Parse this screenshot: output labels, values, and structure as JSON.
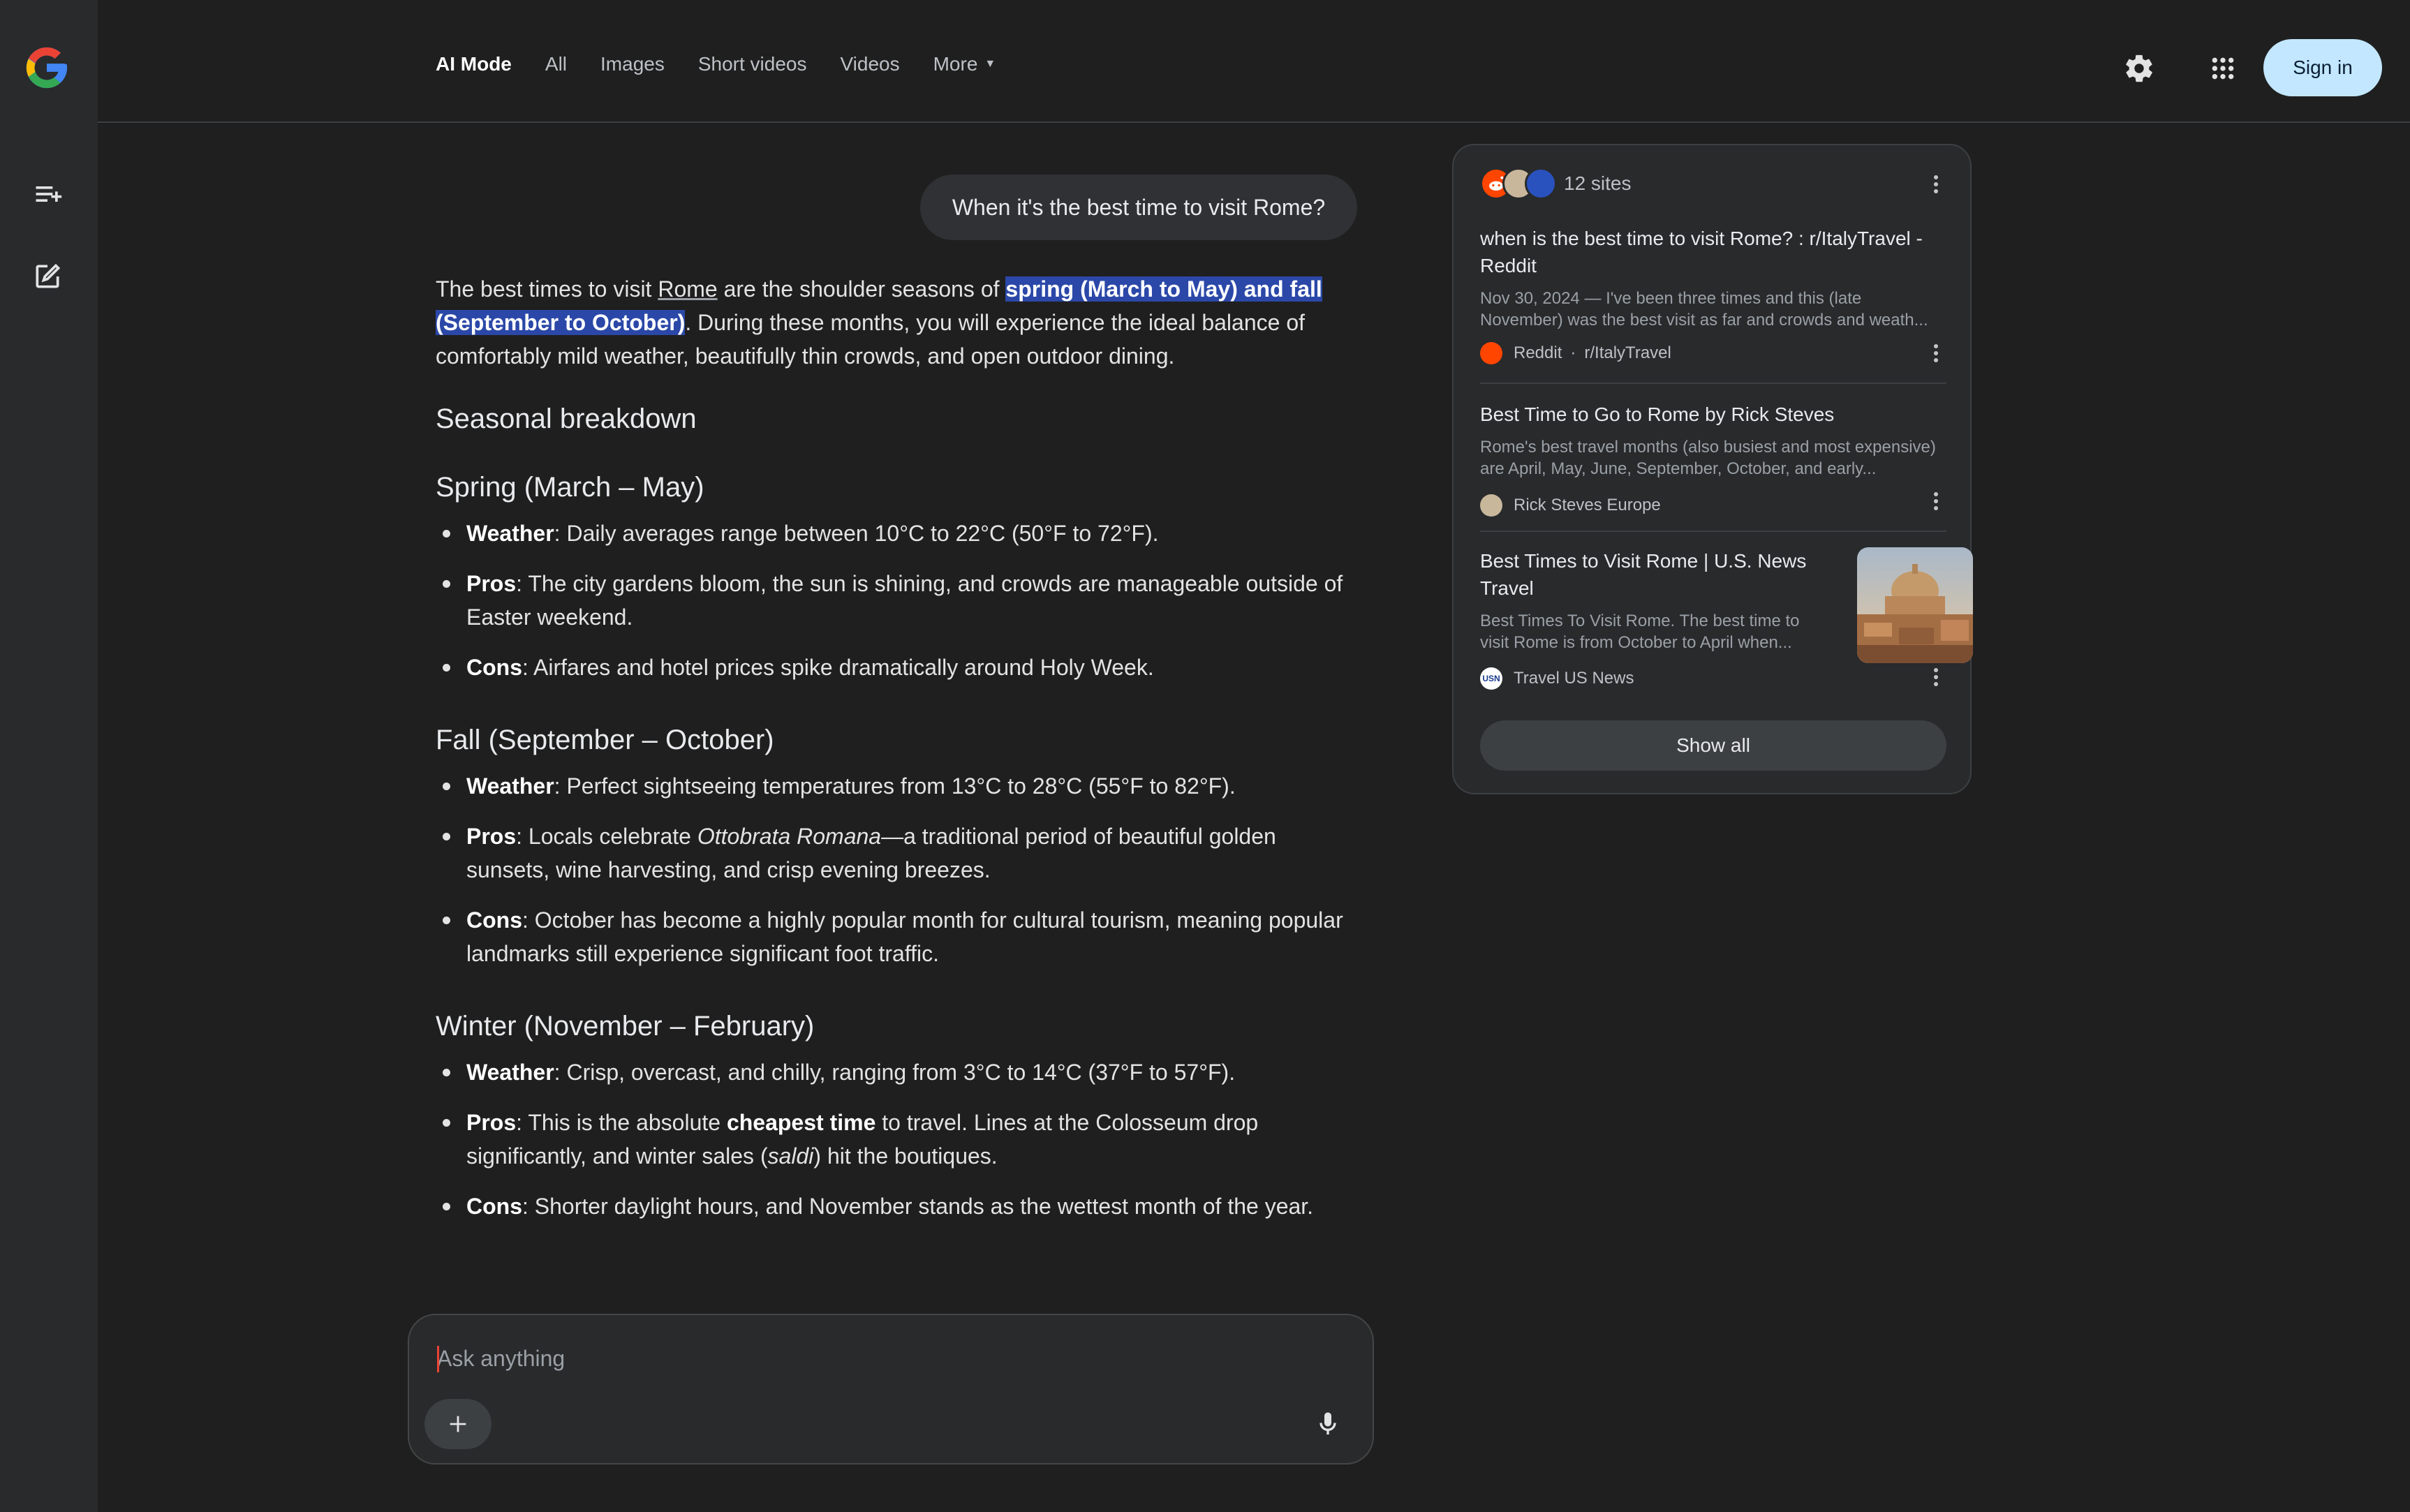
{
  "nav": {
    "tabs": [
      {
        "label": "AI Mode",
        "active": true
      },
      {
        "label": "All"
      },
      {
        "label": "Images"
      },
      {
        "label": "Short videos"
      },
      {
        "label": "Videos"
      },
      {
        "label": "More"
      }
    ],
    "sign_in_label": "Sign in",
    "icons": [
      "google-logo",
      "search-history-icon",
      "new-chat-icon",
      "settings-gear-icon",
      "apps-grid-icon",
      "caret-down-icon"
    ]
  },
  "conversation": {
    "user_query": "When it's the best time to visit Rome?",
    "intro": {
      "prefix": "The best times to visit ",
      "rome_link": "Rome",
      "middle": " are the shoulder seasons of ",
      "highlight": "spring (March to May) and fall (September to October)",
      "suffix": ". During these months, you will experience the ideal balance of comfortably mild weather, beautifully thin crowds, and open outdoor dining."
    },
    "breakdown_heading": "Seasonal breakdown",
    "spring": {
      "heading": "Spring (March – May)",
      "weather_label": "Weather",
      "weather_text": ": Daily averages range between 10°C to 22°C (50°F to 72°F).",
      "pros_label": "Pros",
      "pros_text": ": The city gardens bloom, the sun is shining, and crowds are manageable outside of Easter weekend.",
      "cons_label": "Cons",
      "cons_text": ": Airfares and hotel prices spike dramatically around Holy Week."
    },
    "fall": {
      "heading": "Fall (September – October)",
      "weather_label": "Weather",
      "weather_text": ": Perfect sightseeing temperatures from 13°C to 28°C (55°F to 82°F).",
      "pros_label": "Pros",
      "pros_pre": ": Locals celebrate ",
      "pros_italic": "Ottobrata Romana",
      "pros_post": "—a traditional period of beautiful golden sunsets, wine harvesting, and crisp evening breezes.",
      "cons_label": "Cons",
      "cons_text": ": October has become a highly popular month for cultural tourism, meaning popular landmarks still experience significant foot traffic."
    },
    "winter": {
      "heading": "Winter (November – February)",
      "weather_label": "Weather",
      "weather_text": ": Crisp, overcast, and chilly, ranging from 3°C to 14°C (37°F to 57°F).",
      "pros_label": "Pros",
      "pros_pre": ": This is the absolute ",
      "pros_bold": "cheapest time",
      "pros_mid": " to travel. Lines at the Colosseum drop significantly, and winter sales (",
      "pros_italic": "saldi",
      "pros_post": ") hit the boutiques.",
      "cons_label": "Cons",
      "cons_text": ": Shorter daylight hours, and November stands as the wettest month of the year."
    }
  },
  "composer": {
    "placeholder": "Ask anything"
  },
  "sources": {
    "count_label": "12 sites",
    "show_all_label": "Show all",
    "items": [
      {
        "title": "when is the best time to visit Rome? : r/ItalyTravel - Reddit",
        "snippet": "Nov 30, 2024 — I've been three times and this (late November) was the best visit as far and crowds and weath...",
        "site": "Reddit",
        "site_sub": "r/ItalyTravel"
      },
      {
        "title": "Best Time to Go to Rome by Rick Steves",
        "snippet": "Rome's best travel months (also busiest and most expensive) are April, May, June, September, October, and early...",
        "site": "Rick Steves Europe"
      },
      {
        "title": "Best Times to Visit Rome | U.S. News Travel",
        "snippet": "Best Times To Visit Rome. The best time to visit Rome is from October to April when...",
        "site": "Travel US News",
        "site_logo_text": "USN"
      }
    ]
  },
  "colors": {
    "background": "#1f1f1f",
    "rail": "#282a2c",
    "highlight": "#2b48a8",
    "sign_in": "#c2e7ff"
  }
}
